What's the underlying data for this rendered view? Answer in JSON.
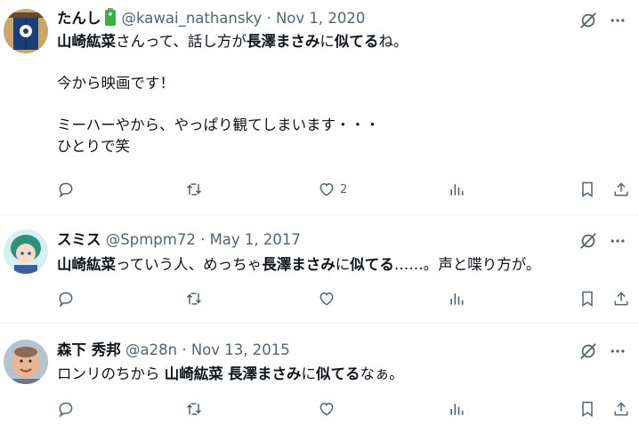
{
  "tweets": [
    {
      "name": "たんし",
      "handle": "@kawai_nathansky",
      "sep": "·",
      "date": "Nov 1, 2020",
      "segments": [
        {
          "t": "山崎紘菜",
          "b": true
        },
        {
          "t": "さんって、話し方が",
          "b": false
        },
        {
          "t": "長澤まさみ",
          "b": true
        },
        {
          "t": "に",
          "b": false
        },
        {
          "t": "似てる",
          "b": true
        },
        {
          "t": "ね。\n\n今から映画です！\n\nミーハーやから、やっぱり観てしまいます・・・\nひとりで笑",
          "b": false
        }
      ],
      "like_count": "2",
      "avatar_kind": "noren"
    },
    {
      "name": "スミス",
      "handle": "@Spmpm72",
      "sep": "·",
      "date": "May 1, 2017",
      "segments": [
        {
          "t": "山崎紘菜",
          "b": true
        },
        {
          "t": "っていう人、めっちゃ",
          "b": false
        },
        {
          "t": "長澤まさみ",
          "b": true
        },
        {
          "t": "に",
          "b": false
        },
        {
          "t": "似てる",
          "b": true
        },
        {
          "t": "……。声と喋り方が。",
          "b": false
        }
      ],
      "like_count": "",
      "avatar_kind": "anime"
    },
    {
      "name": "森下 秀邦",
      "handle": "@a28n",
      "sep": "·",
      "date": "Nov 13, 2015",
      "segments": [
        {
          "t": "ロンリのちから ",
          "b": false
        },
        {
          "t": "山崎紘菜",
          "b": true
        },
        {
          "t": " ",
          "b": false
        },
        {
          "t": "長澤まさみ",
          "b": true
        },
        {
          "t": "に",
          "b": false
        },
        {
          "t": "似てる",
          "b": true
        },
        {
          "t": "なぁ。",
          "b": false
        }
      ],
      "like_count": "",
      "avatar_kind": "photo"
    }
  ],
  "icons": {
    "top": [
      "grok-icon",
      "more-icon"
    ],
    "actions": [
      "reply-icon",
      "retweet-icon",
      "like-icon",
      "views-icon",
      "bookmark-icon",
      "share-icon"
    ]
  },
  "colors": {
    "text": "#0f1419",
    "secondary": "#536471",
    "divider": "#eff3f4",
    "battery": "#3cb043"
  }
}
